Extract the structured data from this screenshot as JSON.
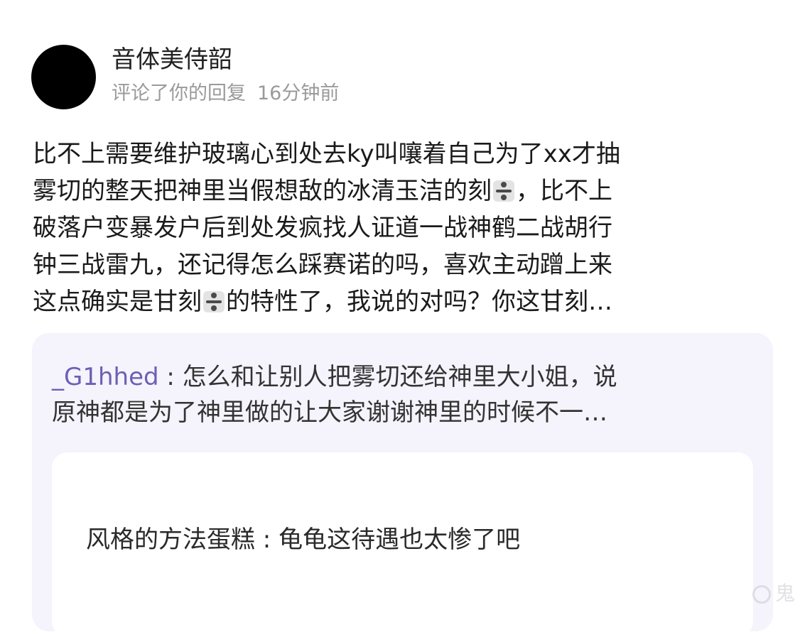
{
  "notification": {
    "username": "音体美侍韶",
    "action": "评论了你的回复",
    "time": "16分钟前"
  },
  "comment": {
    "line1": "比不上需要维护玻璃心到处去ky叫嚷着自己为了xx才抽",
    "line2_a": "雾切的整天把神里当假想敌的冰清玉洁的刻",
    "line2_b": "，比不上",
    "line3": "破落户变暴发户后到处发疯找人证道一战神鹤二战胡行",
    "line4": "钟三战雷九，还记得怎么踩赛诺的吗，喜欢主动蹭上来",
    "line5_a": "这点确实是甘刻",
    "line5_b": "的特性了，我说的对吗？你这甘刻…",
    "emoji_icon": "heavy-division-sign-icon"
  },
  "quoted": {
    "author": "_G1hhed",
    "separator": " : ",
    "line1": "怎么和让别人把雾切还给神里大小姐，说",
    "line2": "原神都是为了神里做的让大家谢谢神里的时候不一…"
  },
  "inner_reply": {
    "text": "风格的方法蛋糕 : 龟龟这待遇也太惨了吧"
  },
  "watermark": {
    "text": "鬼"
  },
  "colors": {
    "author_link": "#6b5fb5",
    "card_bg": "#f5f3fb",
    "meta_gray": "#9a9a9a"
  }
}
